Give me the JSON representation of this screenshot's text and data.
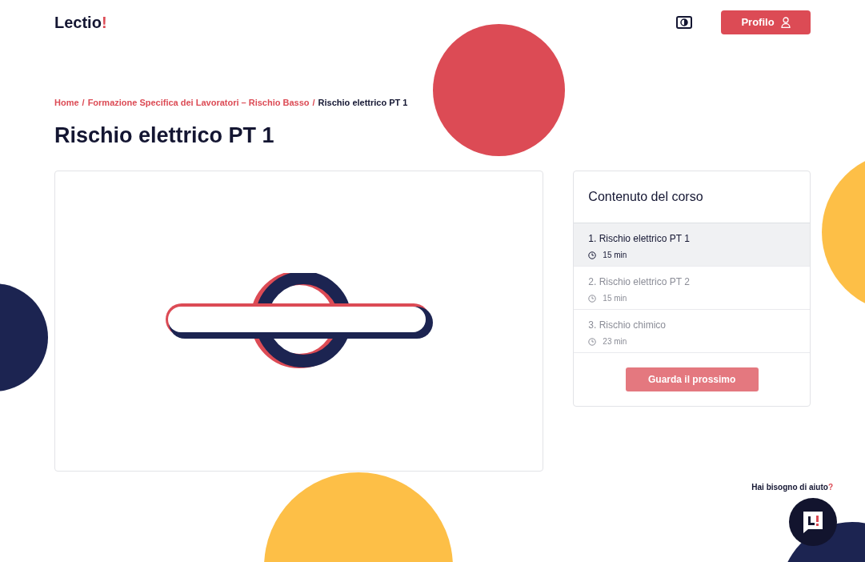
{
  "brand": {
    "name": "Lectio",
    "mark": "!"
  },
  "header": {
    "profile_button": "Profilo"
  },
  "breadcrumb_separator": "/",
  "breadcrumb": [
    {
      "label": "Home",
      "current": false
    },
    {
      "label": "Formazione Specifica dei Lavoratori – Rischio Basso",
      "current": false
    },
    {
      "label": "Rischio elettrico PT 1",
      "current": true
    }
  ],
  "page_title": "Rischio elettrico PT 1",
  "course_panel": {
    "title": "Contenuto del corso",
    "lessons": [
      {
        "title": "1. Rischio elettrico PT 1",
        "duration": "15 min",
        "selected": true
      },
      {
        "title": "2. Rischio elettrico PT 2",
        "duration": "15 min",
        "selected": false
      },
      {
        "title": "3. Rischio chimico",
        "duration": "23 min",
        "selected": false
      }
    ],
    "next_button": {
      "label": "Guarda il prossimo",
      "disabled": true
    }
  },
  "help": {
    "text": "Hai bisogno di aiuto",
    "mark": "?"
  }
}
